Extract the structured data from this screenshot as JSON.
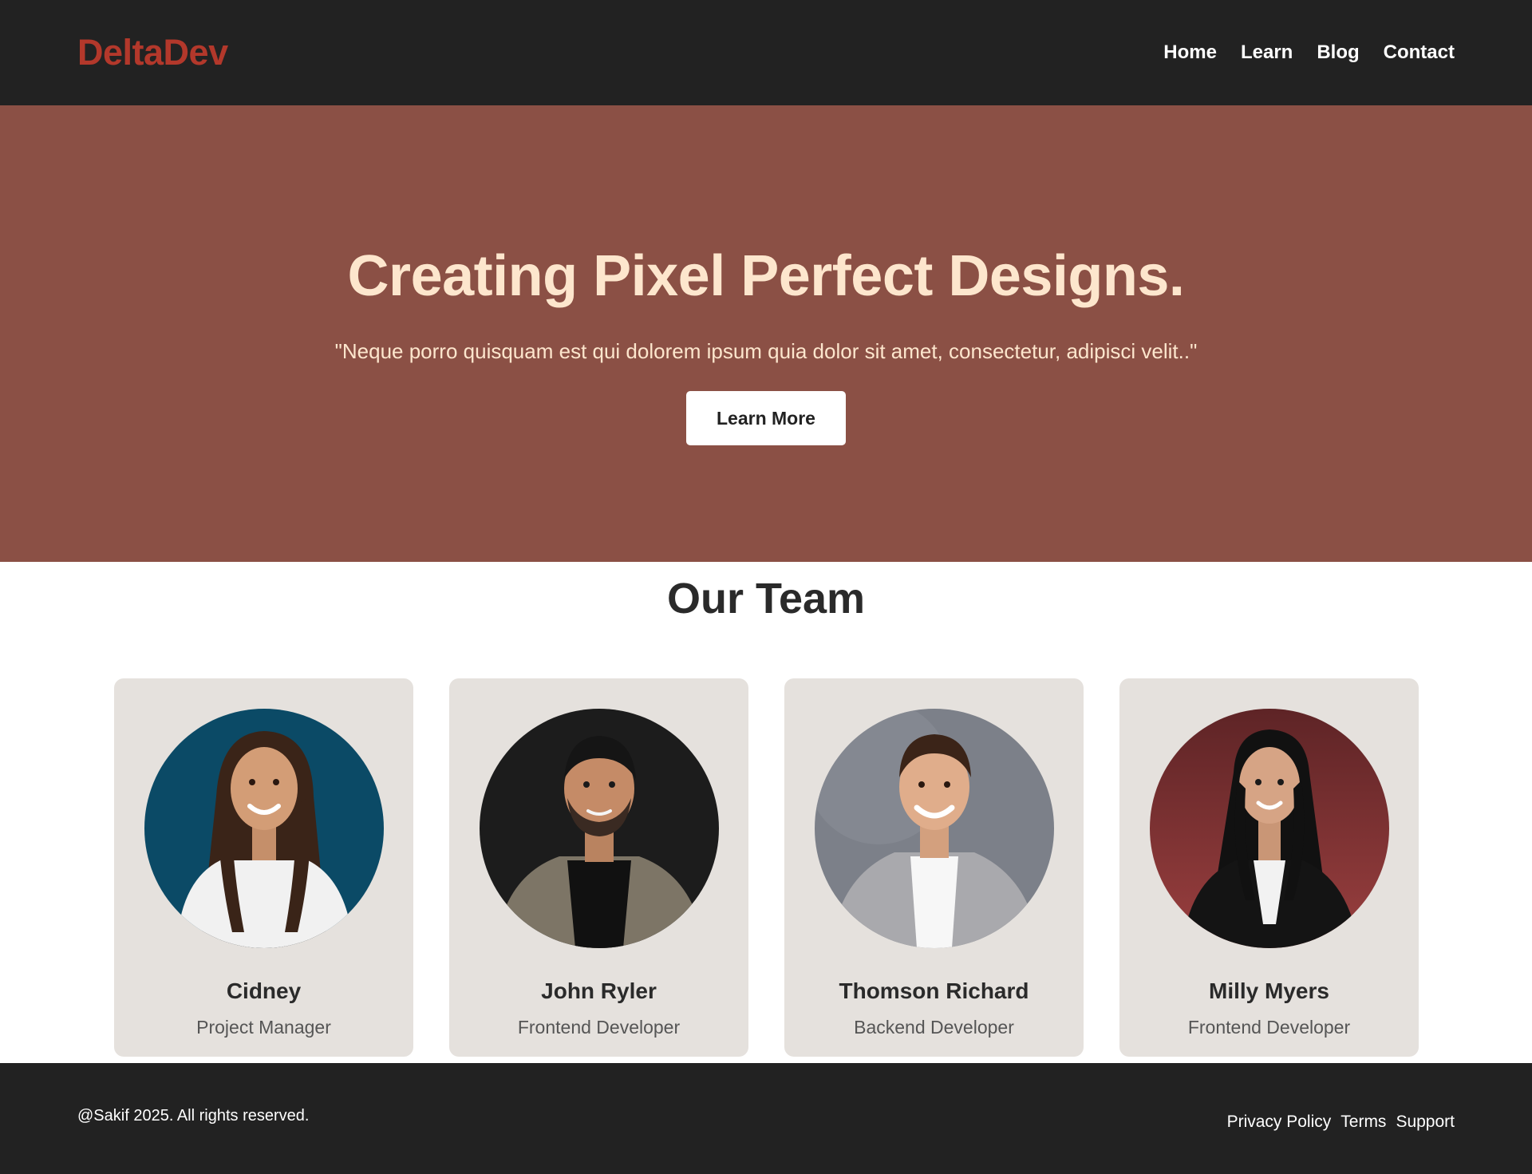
{
  "brand": {
    "name": "DeltaDev",
    "color": "#b3382b"
  },
  "nav": {
    "items": [
      "Home",
      "Learn",
      "Blog",
      "Contact"
    ]
  },
  "hero": {
    "title": "Creating Pixel Perfect Designs.",
    "quote": "\"Neque porro quisquam est qui dolorem ipsum quia dolor sit amet, consectetur, adipisci velit..\"",
    "button_label": "Learn More",
    "background": "#8b5045",
    "text_color": "#fde6cd"
  },
  "team": {
    "heading": "Our Team",
    "members": [
      {
        "name": "Cidney",
        "role": "Project Manager",
        "photo_bg": "#0b4a66"
      },
      {
        "name": "John Ryler",
        "role": "Frontend Developer",
        "photo_bg": "#1c1c1c"
      },
      {
        "name": "Thomson Richard",
        "role": "Backend Developer",
        "photo_bg": "#7c8089"
      },
      {
        "name": "Milly Myers",
        "role": "Frontend Developer",
        "photo_bg": "#7a2c2f"
      }
    ]
  },
  "footer": {
    "copyright": "@Sakif 2025. All rights reserved.",
    "links": [
      "Privacy Policy",
      "Terms",
      "Support"
    ]
  }
}
